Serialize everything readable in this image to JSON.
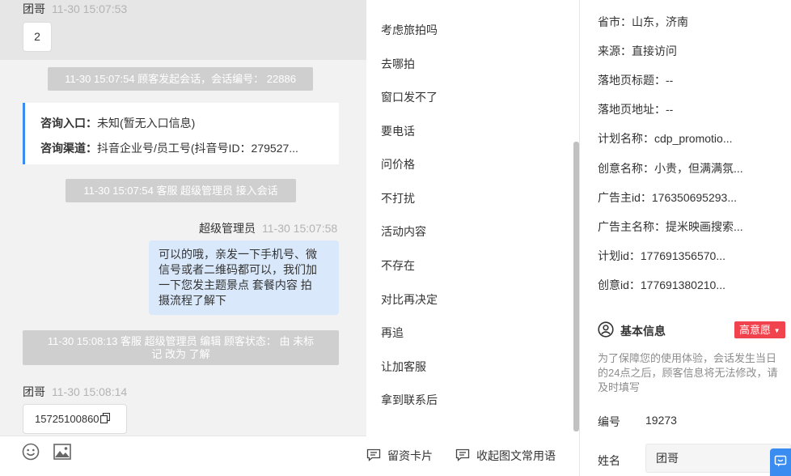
{
  "chat": {
    "msg1": {
      "sender": "团哥",
      "time": "11-30 15:07:53",
      "content": "2"
    },
    "sys1": "11-30 15:07:54 顾客发起会话，会话编号： 22886",
    "entry": {
      "entrance_label": "咨询入口：",
      "entrance_value": "未知(暂无入口信息)",
      "channel_label": "咨询渠道：",
      "channel_value": "抖音企业号/员工号(抖音号ID：279527..."
    },
    "sys2": "11-30 15:07:54 客服 超级管理员 接入会话",
    "msg2": {
      "sender": "超级管理员",
      "time": "11-30 15:07:58",
      "lines": [
        "可以的哦，亲发一下手机号、微",
        "信号或者二维码都可以，我们加",
        "一下您发主题景点 套餐内容 拍",
        "摄流程了解下"
      ]
    },
    "sys3_lines": [
      "11-30 15:08:13 客服 超级管理员 编辑 顾客状态： 由 未标",
      "记 改为 了解"
    ],
    "msg3": {
      "sender": "团哥",
      "time": "11-30 15:08:14",
      "content": "15725100860"
    },
    "toolbar": {
      "emoji_icon": "smiley-icon",
      "image_icon": "image-icon"
    }
  },
  "phrases": {
    "items": [
      "考虑旅拍吗",
      "去哪拍",
      "窗口发不了",
      "要电话",
      "问价格",
      "不打扰",
      "活动内容",
      "不存在",
      "对比再决定",
      "再追",
      "让加客服",
      "拿到联系后"
    ],
    "actions": {
      "card": "留资卡片",
      "collapse": "收起图文常用语"
    }
  },
  "info": {
    "rows": [
      "省市：山东，济南",
      "来源：直接访问",
      "落地页标题：--",
      "落地页地址：--",
      "计划名称：cdp_promotio...",
      "创意名称：小贵，但满满氛...",
      "广告主id：176350695293...",
      "广告主名称：提米映画搜索...",
      "计划id：177691356570...",
      "创意id：177691380210..."
    ],
    "section_title": "基本信息",
    "intent_badge": "高意愿",
    "notice": "为了保障您的使用体验，会话发生当日的24点之后，顾客信息将无法修改，请及时填写",
    "id_label": "编号",
    "id_value": "19273",
    "name_label": "姓名",
    "name_value": "团哥"
  },
  "colors": {
    "accent": "#3b8cf0",
    "badge": "#f0434d",
    "bubble_blue": "#d9e8fb"
  }
}
